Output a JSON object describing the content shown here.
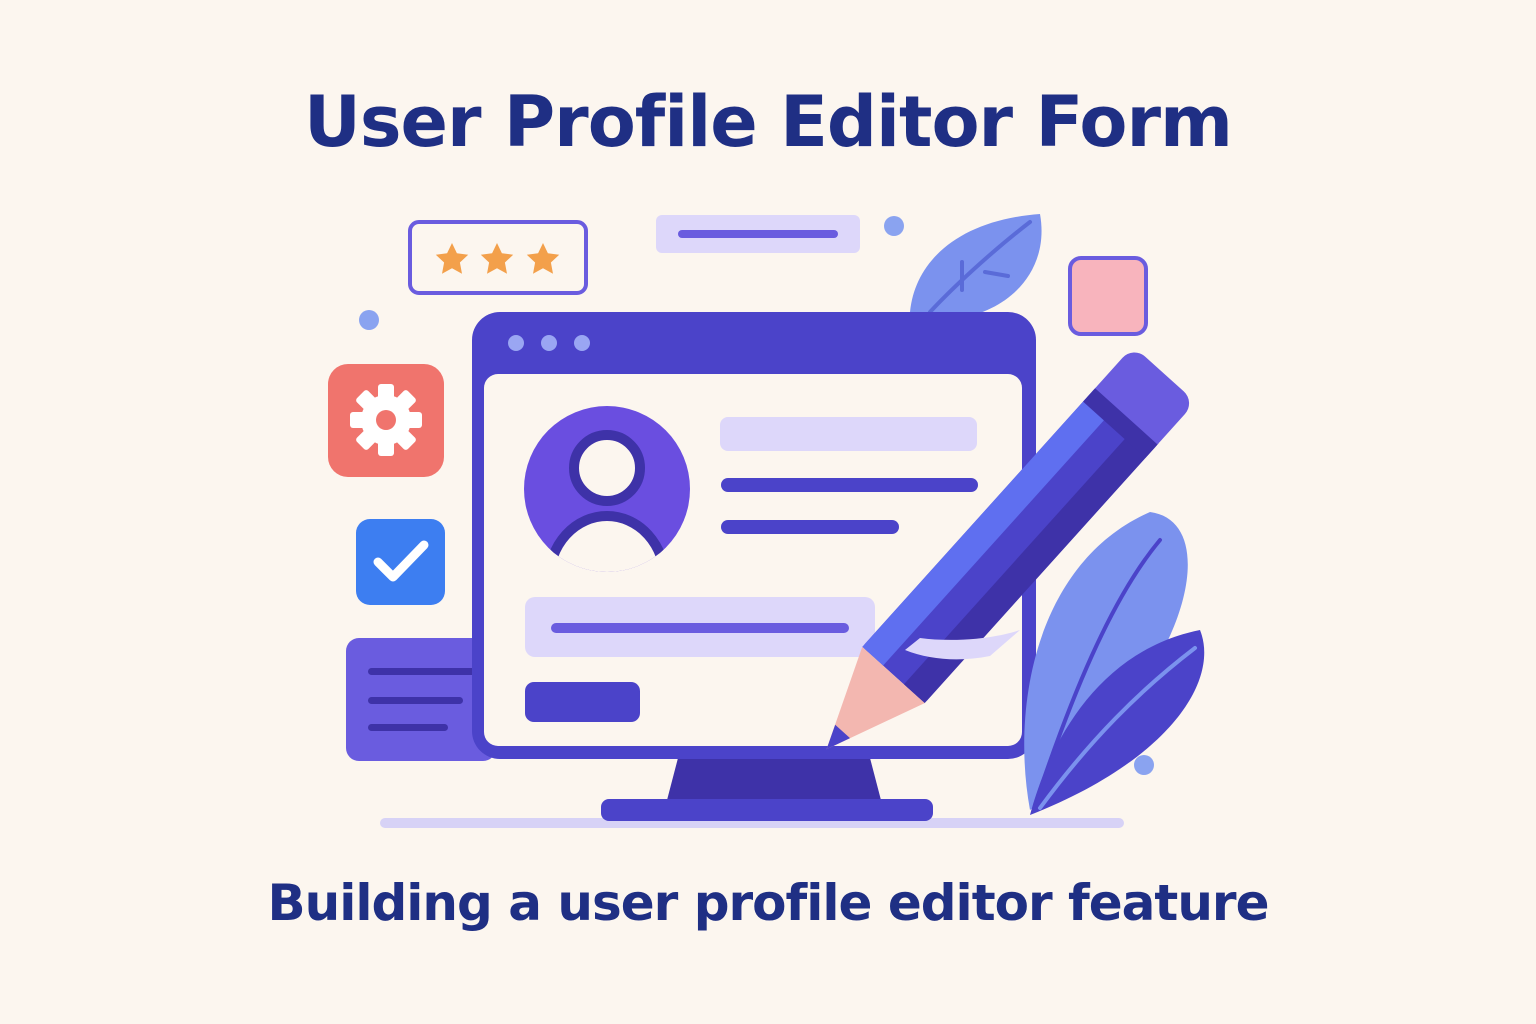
{
  "header": {
    "title": "User Profile Editor Form"
  },
  "footer": {
    "caption": "Building a user profile editor feature"
  },
  "illustration": {
    "icons": [
      "star-icon",
      "gear-icon",
      "checkmark-icon",
      "user-avatar-icon",
      "pencil-icon",
      "leaf-icon"
    ],
    "rating_stars": 3,
    "colors": {
      "background": "#fcf6ef",
      "heading": "#1f2f84",
      "primary": "#4b43c9",
      "accent_light": "#ddd7fa",
      "star": "#f3a04b",
      "gear_tile": "#f0746d",
      "check_tile": "#3d7ef1",
      "pink_square": "#f8b4bd"
    }
  }
}
